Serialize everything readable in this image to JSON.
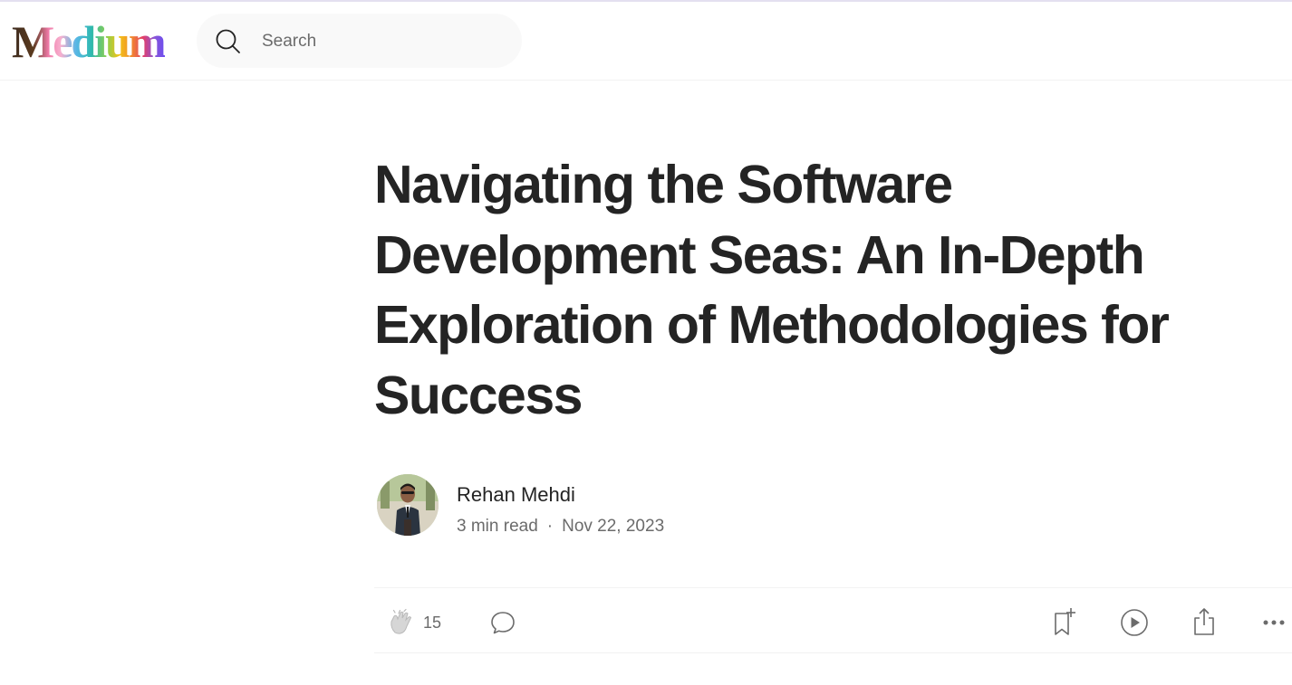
{
  "header": {
    "logo": "Medium",
    "search": {
      "placeholder": "Search",
      "icon": "search-icon"
    }
  },
  "article": {
    "title": "Navigating the Software Development Seas: An In-Depth Exploration of Methodologies for Success",
    "author": {
      "name": "Rehan Mehdi",
      "read_time": "3 min read",
      "separator": "·",
      "date": "Nov 22, 2023"
    },
    "actions": {
      "claps": "15",
      "icons": [
        "clap-icon",
        "comment-icon",
        "bookmark-add-icon",
        "play-icon",
        "share-icon",
        "more-icon"
      ]
    }
  },
  "colors": {
    "text": "#242424",
    "muted": "#6b6b6b",
    "search_bg": "#f9f9f9",
    "divider": "#f2f2f2"
  }
}
